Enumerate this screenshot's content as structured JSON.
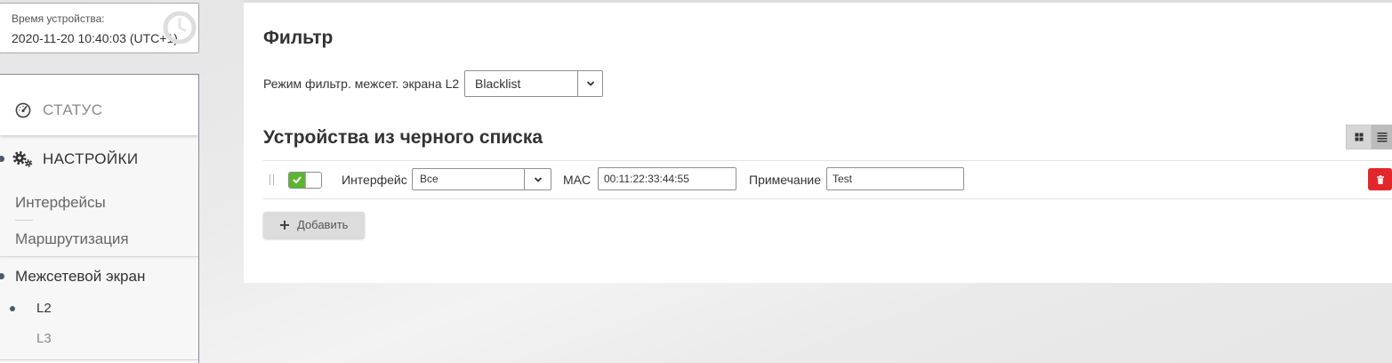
{
  "device_time": {
    "label": "Время устройства:",
    "value": "2020-11-20 10:40:03 (UTC+1)"
  },
  "sidebar": {
    "status": {
      "label": "СТАТУС",
      "icon": "gauge-icon"
    },
    "settings": {
      "label": "НАСТРОЙКИ",
      "icon": "gears-icon",
      "items": [
        {
          "label": "Интерфейсы"
        },
        {
          "label": "Маршрутизация"
        }
      ]
    },
    "firewall": {
      "label": "Межсетевой экран",
      "items": [
        {
          "label": "L2",
          "active": true
        },
        {
          "label": "L3",
          "active": false
        }
      ]
    }
  },
  "filter": {
    "title": "Фильтр",
    "mode_label": "Режим фильтр. межсет. экрана L2",
    "mode_value": "Blacklist"
  },
  "blacklist": {
    "title": "Устройства из черного списка",
    "view_modes": [
      {
        "icon": "grid-icon",
        "selected": false
      },
      {
        "icon": "list-icon",
        "selected": true
      }
    ],
    "rows": [
      {
        "enabled": true,
        "interface_label": "Интерфейс",
        "interface_value": "Все",
        "mac_label": "MAC",
        "mac_value": "00:11:22:33:44:55",
        "note_label": "Примечание",
        "note_value": "Test"
      }
    ],
    "add_label": "Добавить"
  },
  "colors": {
    "toggle_on": "#5cb531",
    "delete_button": "#e3262a",
    "nav_bullet": "#4b5a6b",
    "panel_background": "#ffffff"
  }
}
